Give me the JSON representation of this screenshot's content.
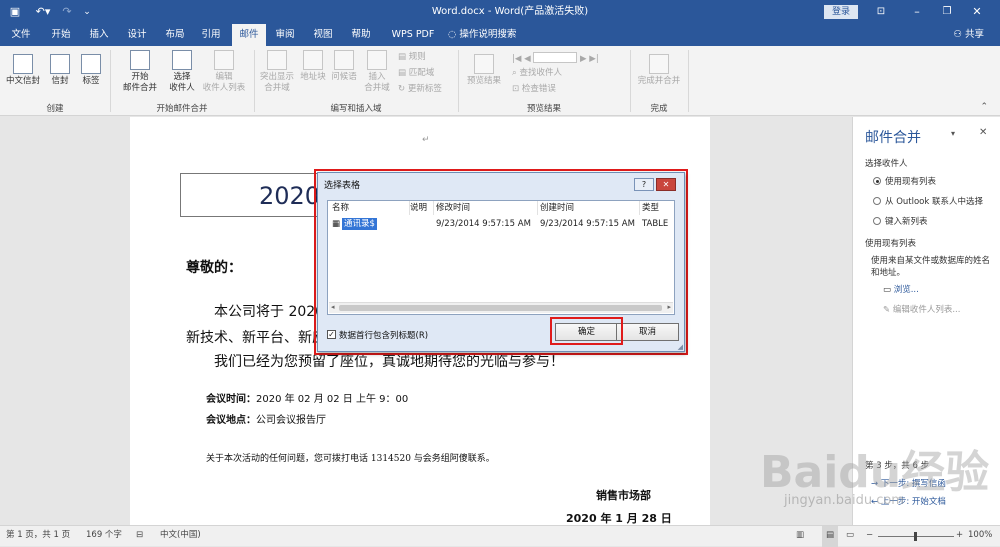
{
  "titlebar": {
    "doc_title": "Word.docx  -  Word(产品激活失败)",
    "login": "登录",
    "save_icon": "save-icon",
    "undo_icon": "undo-icon",
    "redo_icon": "redo-icon",
    "customize_icon": "customize-icon",
    "ribbon_options_icon": "ribbon-options-icon",
    "minimize_icon": "minimize-icon",
    "restore_icon": "restore-icon",
    "close_icon": "close-icon"
  },
  "tabs": [
    "文件",
    "开始",
    "插入",
    "设计",
    "布局",
    "引用",
    "邮件",
    "审阅",
    "视图",
    "帮助",
    "WPS PDF"
  ],
  "active_tab": "邮件",
  "tell_me": "操作说明搜索",
  "share": "共享",
  "ribbon": {
    "create": {
      "label": "创建",
      "chinese_envelope": "中文信封",
      "envelope": "信封",
      "labels": "标签"
    },
    "start": {
      "label": "开始邮件合并",
      "start_merge": "开始\n邮件合并",
      "select_recipients": "选择\n收件人",
      "edit_list": "编辑\n收件人列表"
    },
    "write": {
      "label": "编写和插入域",
      "highlight": "突出显示\n合并域",
      "address_block": "地址块",
      "greeting": "问候语",
      "insert_field": "插入\n合并域",
      "rules": "规则",
      "match_fields": "匹配域",
      "update_labels": "更新标签"
    },
    "preview": {
      "label": "预览结果",
      "preview_results": "预览结果",
      "find_recipient": "查找收件人",
      "check_errors": "检查错误"
    },
    "finish": {
      "label": "完成",
      "finish_merge": "完成并合并"
    }
  },
  "document": {
    "year_box": "2020",
    "salutation": "尊敬的：",
    "para1": "本公司将于 2020",
    "para2": "新技术、新平台、新应",
    "para3": "我们已经为您预留了座位，真诚地期待您的光临与参与！",
    "meeting_time_label": "会议时间：",
    "meeting_time": "2020 年 02 月 02 日 上午 9：00",
    "meeting_place_label": "会议地点：",
    "meeting_place": "公司会议报告厅",
    "contact": "关于本次活动的任何问题，您可拨打电话 1314520 与会务组阿傻联系。",
    "dept": "销售市场部",
    "date": "2020 年 1 月 28 日"
  },
  "dialog": {
    "title": "选择表格",
    "help": "?",
    "close": "✕",
    "columns": [
      "名称",
      "说明",
      "修改时间",
      "创建时间",
      "类型"
    ],
    "rows": [
      {
        "name": "通讯录$",
        "desc": "",
        "modified": "9/23/2014 9:57:15 AM",
        "created": "9/23/2014 9:57:15 AM",
        "type": "TABLE"
      }
    ],
    "checkbox_label": "数据首行包含列标题(R)",
    "checkbox_checked": true,
    "ok": "确定",
    "cancel": "取消"
  },
  "pane": {
    "title": "邮件合并",
    "select_recipients": "选择收件人",
    "option1": "使用现有列表",
    "option2": "从 Outlook 联系人中选择",
    "option3": "键入新列表",
    "use_existing": "使用现有列表",
    "desc": "使用来自某文件或数据库的姓名和地址。",
    "browse": "浏览...",
    "edit_list": "编辑收件人列表...",
    "step": "第 3 步，共 6 步",
    "next": "下一步: 撰写信函",
    "prev": "上一步: 开始文档"
  },
  "statusbar": {
    "page": "第 1 页，共 1 页",
    "words": "169 个字",
    "lang": "中文(中国)",
    "zoom": "100%"
  },
  "watermark": {
    "text": "Baidu经验",
    "url": "jingyan.baidu.com"
  }
}
